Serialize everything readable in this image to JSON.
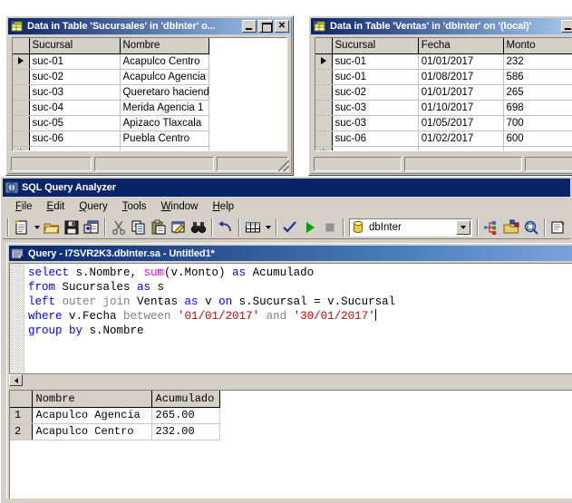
{
  "windows": {
    "sucursales": {
      "title": "Data in Table 'Sucursales' in 'dbInter' o...",
      "icon": "table-datasheet-icon",
      "buttons": {
        "minimize": "_",
        "maximize": "□",
        "close": "✕"
      },
      "columns": [
        "Sucursal",
        "Nombre"
      ],
      "rows": [
        {
          "marker": "▶",
          "Sucursal": "suc-01",
          "Nombre": "Acapulco Centro"
        },
        {
          "marker": "",
          "Sucursal": "suc-02",
          "Nombre": "Acapulco Agencia"
        },
        {
          "marker": "",
          "Sucursal": "suc-03",
          "Nombre": "Queretaro haciend"
        },
        {
          "marker": "",
          "Sucursal": "suc-04",
          "Nombre": "Merida Agencia 1"
        },
        {
          "marker": "",
          "Sucursal": "suc-05",
          "Nombre": "Apizaco Tlaxcala"
        },
        {
          "marker": "",
          "Sucursal": "suc-06",
          "Nombre": "Puebla Centro"
        }
      ],
      "new_row_marker": "✳",
      "status_panes": [
        "",
        "",
        ""
      ]
    },
    "ventas": {
      "title": "Data in Table 'Ventas' in 'dbInter' on '(local)'",
      "icon": "table-datasheet-icon",
      "buttons": {
        "minimize": "_"
      },
      "columns": [
        "Sucursal",
        "Fecha",
        "Monto"
      ],
      "rows": [
        {
          "marker": "▶",
          "Sucursal": "suc-01",
          "Fecha": "01/01/2017",
          "Monto": "232"
        },
        {
          "marker": "",
          "Sucursal": "suc-01",
          "Fecha": "01/08/2017",
          "Monto": "586"
        },
        {
          "marker": "",
          "Sucursal": "suc-02",
          "Fecha": "01/01/2017",
          "Monto": "265"
        },
        {
          "marker": "",
          "Sucursal": "suc-03",
          "Fecha": "01/10/2017",
          "Monto": "698"
        },
        {
          "marker": "",
          "Sucursal": "suc-03",
          "Fecha": "01/05/2017",
          "Monto": "700"
        },
        {
          "marker": "",
          "Sucursal": "suc-06",
          "Fecha": "01/02/2017",
          "Monto": "600"
        }
      ],
      "new_row_marker": "✳",
      "status_panes": [
        "",
        "",
        ""
      ]
    }
  },
  "app": {
    "title": "SQL Query Analyzer",
    "icon": "sql-query-analyzer-icon",
    "menu": [
      {
        "label": "File",
        "accel": "F"
      },
      {
        "label": "Edit",
        "accel": "E"
      },
      {
        "label": "Query",
        "accel": "Q"
      },
      {
        "label": "Tools",
        "accel": "T"
      },
      {
        "label": "Window",
        "accel": "W"
      },
      {
        "label": "Help",
        "accel": "H"
      }
    ],
    "toolbar": {
      "icons": [
        "new-query-icon",
        "new-query-dropdown-icon",
        "open-file-icon",
        "save-query-icon",
        "insert-template-icon",
        "cut-icon",
        "copy-icon",
        "paste-icon",
        "clear-window-icon",
        "find-icon",
        "undo-icon",
        "results-grid-icon",
        "results-grid-dropdown-icon",
        "parse-query-icon",
        "execute-query-icon",
        "cancel-query-icon",
        "estimated-plan-icon",
        "object-browser-icon",
        "show-execution-plan-icon",
        "current-connection-properties-icon"
      ],
      "database_selector": {
        "value": "dbInter",
        "icon": "database-cylinder-icon",
        "dropdown": "chevron-down-icon"
      }
    }
  },
  "query_window": {
    "title": "Query - I7SVR2K3.dbInter.sa - Untitled1*",
    "icon": "query-window-icon",
    "sql_lines": [
      [
        {
          "t": "select ",
          "c": "kw"
        },
        {
          "t": "s.Nombre, ",
          "c": ""
        },
        {
          "t": "sum",
          "c": "fn"
        },
        {
          "t": "(v.Monto) ",
          "c": ""
        },
        {
          "t": "as ",
          "c": "kw"
        },
        {
          "t": "Acumulado",
          "c": ""
        }
      ],
      [
        {
          "t": "from ",
          "c": "kw"
        },
        {
          "t": "Sucursales ",
          "c": ""
        },
        {
          "t": "as ",
          "c": "kw"
        },
        {
          "t": "s",
          "c": ""
        }
      ],
      [
        {
          "t": "left ",
          "c": "kw"
        },
        {
          "t": "outer join ",
          "c": "gray"
        },
        {
          "t": "Ventas ",
          "c": ""
        },
        {
          "t": "as ",
          "c": "kw"
        },
        {
          "t": "v ",
          "c": ""
        },
        {
          "t": "on ",
          "c": "kw"
        },
        {
          "t": "s.Sucursal = v.Sucursal",
          "c": ""
        }
      ],
      [
        {
          "t": "where ",
          "c": "kw"
        },
        {
          "t": "v.Fecha ",
          "c": ""
        },
        {
          "t": "between ",
          "c": "gray"
        },
        {
          "t": "'01/01/2017' ",
          "c": "str"
        },
        {
          "t": "and ",
          "c": "gray"
        },
        {
          "t": "'30/01/2017'",
          "c": "str"
        }
      ],
      [
        {
          "t": "group by ",
          "c": "kw"
        },
        {
          "t": "s.Nombre",
          "c": ""
        }
      ]
    ],
    "results": {
      "columns": [
        "",
        "Nombre",
        "Acumulado"
      ],
      "rows": [
        {
          "n": "1",
          "Nombre": "Acapulco Agencia",
          "Acumulado": "265.00"
        },
        {
          "n": "2",
          "Nombre": "Acapulco Centro",
          "Acumulado": "232.00"
        }
      ]
    }
  },
  "colors": {
    "titlebar_active": "#0a246a",
    "face": "#d4d0c8",
    "keyword": "#0000ff",
    "function": "#ff00ff",
    "string": "#d40000",
    "comment_gray": "#808080"
  }
}
